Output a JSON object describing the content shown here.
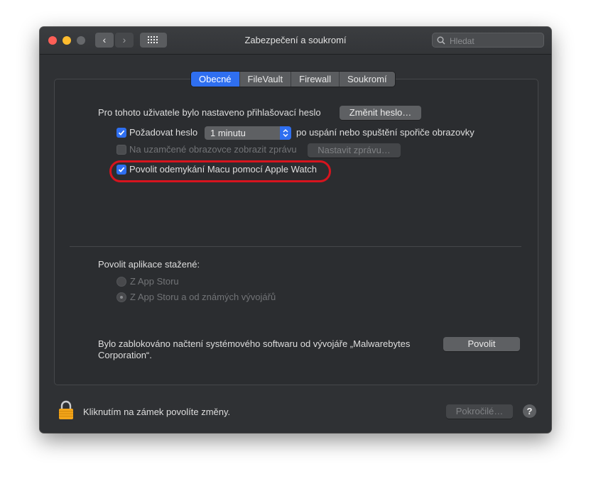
{
  "window": {
    "title": "Zabezpečení a soukromí",
    "search_placeholder": "Hledat"
  },
  "tabs": [
    {
      "label": "Obecné",
      "active": true
    },
    {
      "label": "FileVault",
      "active": false
    },
    {
      "label": "Firewall",
      "active": false
    },
    {
      "label": "Soukromí",
      "active": false
    }
  ],
  "general": {
    "password_text": "Pro tohoto uživatele bylo nastaveno přihlašovací heslo",
    "change_password_button": "Změnit heslo…",
    "require_password": {
      "checked": true,
      "label": "Požadovat heslo",
      "delay_value": "1 minutu",
      "suffix": "po uspání nebo spuštění spořiče obrazovky"
    },
    "lock_message": {
      "checked": false,
      "enabled": false,
      "label": "Na uzamčené obrazovce zobrazit zprávu",
      "button": "Nastavit zprávu…"
    },
    "apple_watch": {
      "checked": true,
      "label": "Povolit odemykání Macu pomocí Apple Watch"
    }
  },
  "downloads": {
    "heading": "Povolit aplikace stažené:",
    "options": [
      {
        "label": "Z App Storu",
        "selected": false
      },
      {
        "label": "Z App Storu a od známých vývojářů",
        "selected": true
      }
    ]
  },
  "blocked": {
    "line1": "Bylo zablokováno načtení systémového softwaru od vývojáře „Malwarebytes",
    "line2": "Corporation“.",
    "allow_button": "Povolit"
  },
  "footer": {
    "lock_text": "Kliknutím na zámek povolíte změny.",
    "advanced_button": "Pokročilé…",
    "help_label": "?"
  },
  "colors": {
    "accent": "#2f6ff0",
    "highlight_ring": "#d7141e"
  }
}
